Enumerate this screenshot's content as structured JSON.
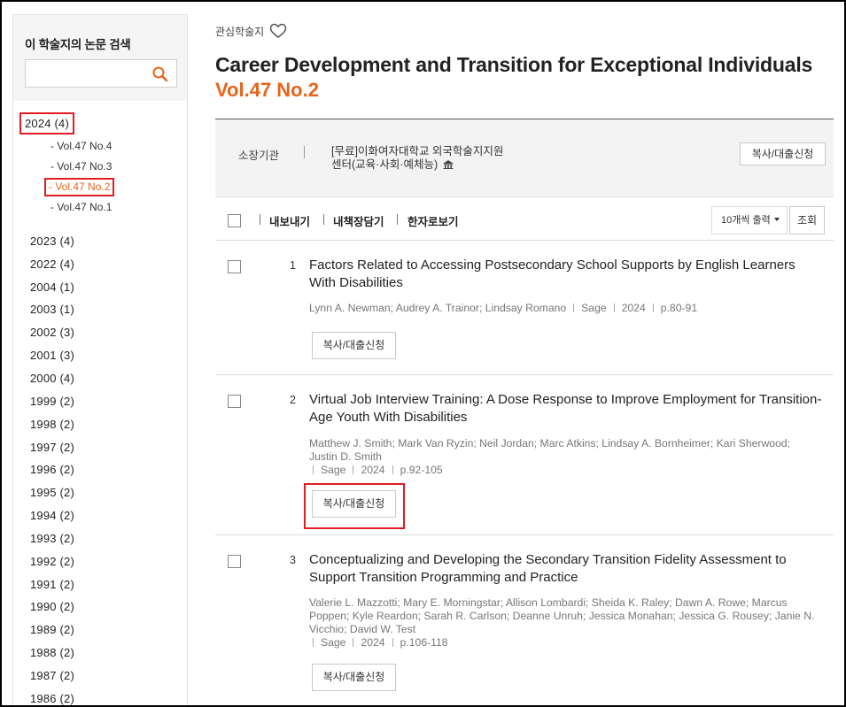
{
  "sidebar": {
    "title": "이 학술지의 논문 검색",
    "search_value": "",
    "years": [
      {
        "label": "2024 (4)",
        "active": true
      },
      {
        "label": "2023 (4)"
      },
      {
        "label": "2022 (4)"
      },
      {
        "label": "2004 (1)"
      },
      {
        "label": "2003 (1)"
      },
      {
        "label": "2002 (3)"
      },
      {
        "label": "2001 (3)"
      },
      {
        "label": "2000 (4)"
      },
      {
        "label": "1999 (2)"
      },
      {
        "label": "1998 (2)"
      },
      {
        "label": "1997 (2)"
      },
      {
        "label": "1996 (2)"
      },
      {
        "label": "1995 (2)"
      },
      {
        "label": "1994 (2)"
      },
      {
        "label": "1993 (2)"
      },
      {
        "label": "1992 (2)"
      },
      {
        "label": "1991 (2)"
      },
      {
        "label": "1990 (2)"
      },
      {
        "label": "1989 (2)"
      },
      {
        "label": "1988 (2)"
      },
      {
        "label": "1987 (2)"
      },
      {
        "label": "1986 (2)"
      }
    ],
    "volumes": [
      {
        "label": "- Vol.47 No.4"
      },
      {
        "label": "- Vol.47 No.3"
      },
      {
        "label": "- Vol.47 No.2",
        "active": true
      },
      {
        "label": "- Vol.47 No.1"
      }
    ]
  },
  "header": {
    "favorite_label": "관심학술지",
    "journal_title": "Career Development and Transition for Exceptional Individuals",
    "volume": "Vol.47 No.2"
  },
  "holding": {
    "label": "소장기관",
    "institution_line1": "[무료]이화여자대학교 외국학술지지원",
    "institution_line2": "센터(교육·사회·예체능)",
    "button": "복사/대출신청"
  },
  "toolbar": {
    "export": "내보내기",
    "save": "내책장담기",
    "hanja": "한자로보기",
    "per_page": "10개씩 출력",
    "view_button": "조회"
  },
  "articles": [
    {
      "num": "1",
      "title": "Factors Related to Accessing Postsecondary School Supports by English Learners With Disabilities",
      "authors": "Lynn A. Newman; Audrey A. Trainor; Lindsay Romano",
      "publisher": "Sage",
      "year": "2024",
      "pages": "p.80-91",
      "button": "복사/대출신청"
    },
    {
      "num": "2",
      "title": "Virtual Job Interview Training: A Dose Response to Improve Employment for Transition-Age Youth With Disabilities",
      "authors": "Matthew J. Smith; Mark Van Ryzin; Neil Jordan; Marc Atkins; Lindsay A. Bornheimer; Kari Sherwood; Justin D. Smith",
      "publisher": "Sage",
      "year": "2024",
      "pages": "p.92-105",
      "button": "복사/대출신청"
    },
    {
      "num": "3",
      "title": "Conceptualizing and Developing the Secondary Transition Fidelity Assessment to Support Transition Programming and Practice",
      "authors": "Valerie L. Mazzotti; Mary E. Morningstar; Allison Lombardi; Sheida K. Raley; Dawn A. Rowe; Marcus Poppen; Kyle Reardon; Sarah R. Carlson; Deanne Unruh; Jessica Monahan; Jessica G. Rousey; Janie N. Vicchio; David W. Test",
      "publisher": "Sage",
      "year": "2024",
      "pages": "p.106-118",
      "button": "복사/대출신청"
    }
  ],
  "colors": {
    "accent": "#e8641c",
    "highlight": "#e31b23"
  }
}
